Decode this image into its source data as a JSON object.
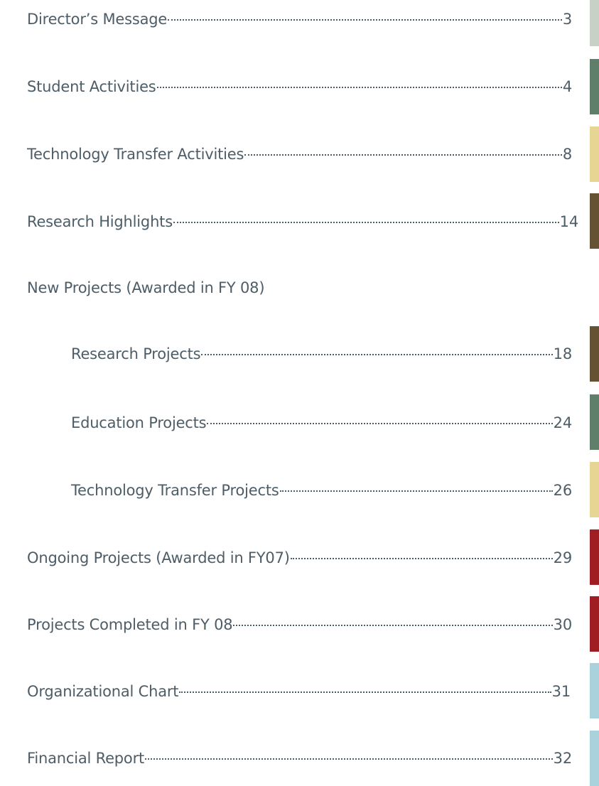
{
  "toc": {
    "entries": [
      {
        "title": "Director’s Message",
        "page": "3",
        "tab_color": "#c8d1c6",
        "indent": 0,
        "has_page": true
      },
      {
        "title": "Student Activities",
        "page": "4",
        "tab_color": "#5f7f6a",
        "indent": 0,
        "has_page": true
      },
      {
        "title": "Technology Transfer Activities",
        "page": "8",
        "tab_color": "#e7d593",
        "indent": 0,
        "has_page": true
      },
      {
        "title": "Research Highlights",
        "page": "14",
        "tab_color": "#655232",
        "indent": 0,
        "has_page": true
      },
      {
        "title": "New Projects (Awarded in FY 08)",
        "page": "",
        "tab_color": "",
        "indent": 0,
        "has_page": false
      },
      {
        "title": "Research Projects",
        "page": "18",
        "tab_color": "#655232",
        "indent": 1,
        "has_page": true
      },
      {
        "title": "Education Projects",
        "page": "24",
        "tab_color": "#5f7f6a",
        "indent": 1,
        "has_page": true
      },
      {
        "title": "Technology Transfer Projects",
        "page": "26",
        "tab_color": "#e7d593",
        "indent": 1,
        "has_page": true
      },
      {
        "title": "Ongoing Projects (Awarded in FY07)",
        "page": "29",
        "tab_color": "#a01d22",
        "indent": 0,
        "has_page": true
      },
      {
        "title": "Projects Completed in FY 08",
        "page": "30",
        "tab_color": "#a01d22",
        "indent": 0,
        "has_page": true
      },
      {
        "title": "Organizational Chart",
        "page": "31",
        "tab_color": "#a9d2dc",
        "indent": 0,
        "has_page": true
      },
      {
        "title": "Financial Report",
        "page": "32",
        "tab_color": "#a9d2dc",
        "indent": 0,
        "has_page": true
      }
    ]
  }
}
